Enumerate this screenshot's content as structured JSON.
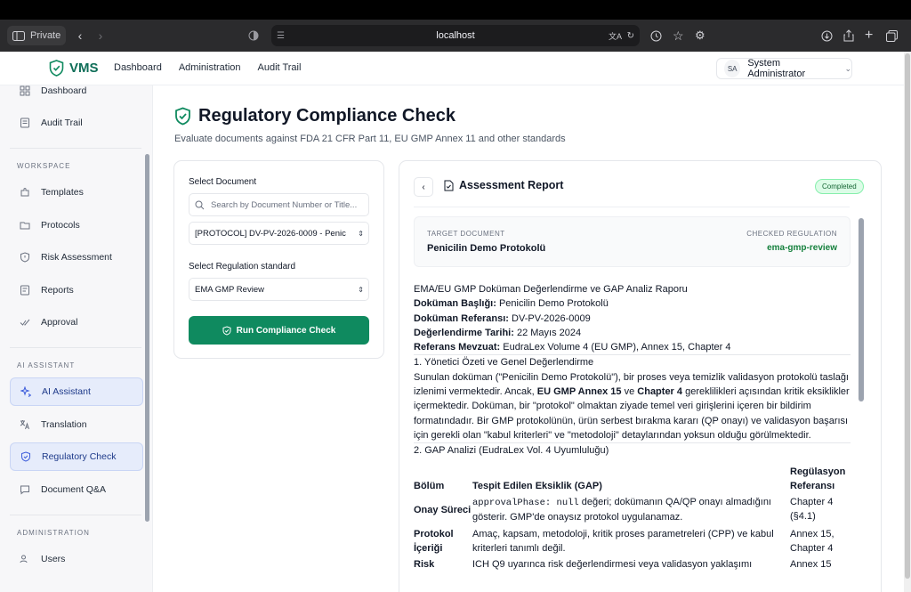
{
  "browser": {
    "mode": "Private",
    "url": "localhost"
  },
  "header": {
    "brand": "VMS",
    "nav": [
      "Dashboard",
      "Administration",
      "Audit Trail"
    ],
    "user_initials": "SA",
    "user_name": "System Administrator"
  },
  "sidebar": {
    "items_top": [
      "Dashboard",
      "Audit Trail"
    ],
    "workspace_title": "WORKSPACE",
    "workspace": [
      "Templates",
      "Protocols",
      "Risk Assessment",
      "Reports",
      "Approval"
    ],
    "ai_title": "AI ASSISTANT",
    "ai": [
      "AI Assistant",
      "Translation",
      "Regulatory Check",
      "Document Q&A"
    ],
    "admin_title": "ADMINISTRATION",
    "admin": [
      "Users"
    ]
  },
  "page": {
    "title": "Regulatory Compliance Check",
    "subtitle": "Evaluate documents against FDA 21 CFR Part 11, EU GMP Annex 11 and other standards"
  },
  "form": {
    "select_document_label": "Select Document",
    "search_placeholder": "Search by Document Number or Title...",
    "document_value": "[PROTOCOL] DV-PV-2026-0009 - Penic",
    "regulation_label": "Select Regulation standard",
    "regulation_value": "EMA GMP Review",
    "run_button": "Run Compliance Check"
  },
  "report": {
    "title": "Assessment Report",
    "status": "Completed",
    "target_label": "TARGET DOCUMENT",
    "target_value": "Penicilin Demo Protokolü",
    "regulation_label": "CHECKED REGULATION",
    "regulation_value": "ema-gmp-review",
    "heading": "EMA/EU GMP Doküman Değerlendirme ve GAP Analiz Raporu",
    "meta": [
      {
        "k": "Doküman Başlığı:",
        "v": "Penicilin Demo Protokolü"
      },
      {
        "k": "Doküman Referansı:",
        "v": "DV-PV-2026-0009"
      },
      {
        "k": "Değerlendirme Tarihi:",
        "v": "22 Mayıs 2024"
      },
      {
        "k": "Referans Mevzuat:",
        "v": "EudraLex Volume 4 (EU GMP), Annex 15, Chapter 4"
      }
    ],
    "section1": "1. Yönetici Özeti ve Genel Değerlendirme",
    "p1_a": "Sunulan doküman (\"Penicilin Demo Protokolü\"), bir proses veya temizlik validasyon protokolü taslağı izlenimi vermektedir. Ancak, ",
    "p1_b1": "EU GMP Annex 15",
    "p1_c": " ve ",
    "p1_b2": "Chapter 4",
    "p1_d": " gereklilikleri açısından kritik eksiklikler içermektedir. Doküman, bir \"protokol\" olmaktan ziyade temel veri girişlerini içeren bir bildirim formatındadır. Bir GMP protokolünün, ürün serbest bırakma kararı (QP onayı) ve validasyon başarısı için gerekli olan \"kabul kriterleri\" ve \"metodoloji\" detaylarından yoksun olduğu görülmektedir.",
    "section2": "2. GAP Analizi (EudraLex Vol. 4 Uyumluluğu)",
    "table_headers": [
      "Bölüm",
      "Tespit Edilen Eksiklik (GAP)",
      "Regülasyon Referansı"
    ],
    "rows": [
      {
        "section": "Onay Süreci",
        "code": "approvalPhase: null",
        "gap": " değeri; dokümanın QA/QP onayı almadığını gösterir. GMP'de onaysız protokol uygulanamaz.",
        "ref": "Chapter 4 (§4.1)"
      },
      {
        "section": "Protokol İçeriği",
        "code": "",
        "gap": "Amaç, kapsam, metodoloji, kritik proses parametreleri (CPP) ve kabul kriterleri tanımlı değil.",
        "ref": "Annex 15, Chapter 4"
      },
      {
        "section": "Risk",
        "code": "",
        "gap": "ICH Q9 uyarınca risk değerlendirmesi veya validasyon yaklaşımı",
        "ref": "Annex 15"
      }
    ]
  }
}
